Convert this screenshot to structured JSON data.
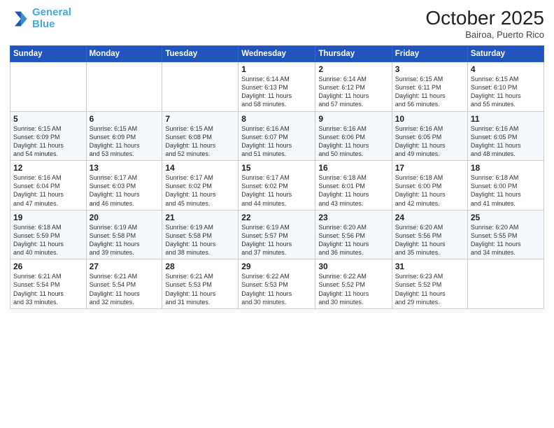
{
  "logo": {
    "line1": "General",
    "line2": "Blue"
  },
  "title": "October 2025",
  "subtitle": "Bairoa, Puerto Rico",
  "days_of_week": [
    "Sunday",
    "Monday",
    "Tuesday",
    "Wednesday",
    "Thursday",
    "Friday",
    "Saturday"
  ],
  "weeks": [
    [
      {
        "day": "",
        "text": ""
      },
      {
        "day": "",
        "text": ""
      },
      {
        "day": "",
        "text": ""
      },
      {
        "day": "1",
        "text": "Sunrise: 6:14 AM\nSunset: 6:13 PM\nDaylight: 11 hours\nand 58 minutes."
      },
      {
        "day": "2",
        "text": "Sunrise: 6:14 AM\nSunset: 6:12 PM\nDaylight: 11 hours\nand 57 minutes."
      },
      {
        "day": "3",
        "text": "Sunrise: 6:15 AM\nSunset: 6:11 PM\nDaylight: 11 hours\nand 56 minutes."
      },
      {
        "day": "4",
        "text": "Sunrise: 6:15 AM\nSunset: 6:10 PM\nDaylight: 11 hours\nand 55 minutes."
      }
    ],
    [
      {
        "day": "5",
        "text": "Sunrise: 6:15 AM\nSunset: 6:09 PM\nDaylight: 11 hours\nand 54 minutes."
      },
      {
        "day": "6",
        "text": "Sunrise: 6:15 AM\nSunset: 6:09 PM\nDaylight: 11 hours\nand 53 minutes."
      },
      {
        "day": "7",
        "text": "Sunrise: 6:15 AM\nSunset: 6:08 PM\nDaylight: 11 hours\nand 52 minutes."
      },
      {
        "day": "8",
        "text": "Sunrise: 6:16 AM\nSunset: 6:07 PM\nDaylight: 11 hours\nand 51 minutes."
      },
      {
        "day": "9",
        "text": "Sunrise: 6:16 AM\nSunset: 6:06 PM\nDaylight: 11 hours\nand 50 minutes."
      },
      {
        "day": "10",
        "text": "Sunrise: 6:16 AM\nSunset: 6:05 PM\nDaylight: 11 hours\nand 49 minutes."
      },
      {
        "day": "11",
        "text": "Sunrise: 6:16 AM\nSunset: 6:05 PM\nDaylight: 11 hours\nand 48 minutes."
      }
    ],
    [
      {
        "day": "12",
        "text": "Sunrise: 6:16 AM\nSunset: 6:04 PM\nDaylight: 11 hours\nand 47 minutes."
      },
      {
        "day": "13",
        "text": "Sunrise: 6:17 AM\nSunset: 6:03 PM\nDaylight: 11 hours\nand 46 minutes."
      },
      {
        "day": "14",
        "text": "Sunrise: 6:17 AM\nSunset: 6:02 PM\nDaylight: 11 hours\nand 45 minutes."
      },
      {
        "day": "15",
        "text": "Sunrise: 6:17 AM\nSunset: 6:02 PM\nDaylight: 11 hours\nand 44 minutes."
      },
      {
        "day": "16",
        "text": "Sunrise: 6:18 AM\nSunset: 6:01 PM\nDaylight: 11 hours\nand 43 minutes."
      },
      {
        "day": "17",
        "text": "Sunrise: 6:18 AM\nSunset: 6:00 PM\nDaylight: 11 hours\nand 42 minutes."
      },
      {
        "day": "18",
        "text": "Sunrise: 6:18 AM\nSunset: 6:00 PM\nDaylight: 11 hours\nand 41 minutes."
      }
    ],
    [
      {
        "day": "19",
        "text": "Sunrise: 6:18 AM\nSunset: 5:59 PM\nDaylight: 11 hours\nand 40 minutes."
      },
      {
        "day": "20",
        "text": "Sunrise: 6:19 AM\nSunset: 5:58 PM\nDaylight: 11 hours\nand 39 minutes."
      },
      {
        "day": "21",
        "text": "Sunrise: 6:19 AM\nSunset: 5:58 PM\nDaylight: 11 hours\nand 38 minutes."
      },
      {
        "day": "22",
        "text": "Sunrise: 6:19 AM\nSunset: 5:57 PM\nDaylight: 11 hours\nand 37 minutes."
      },
      {
        "day": "23",
        "text": "Sunrise: 6:20 AM\nSunset: 5:56 PM\nDaylight: 11 hours\nand 36 minutes."
      },
      {
        "day": "24",
        "text": "Sunrise: 6:20 AM\nSunset: 5:56 PM\nDaylight: 11 hours\nand 35 minutes."
      },
      {
        "day": "25",
        "text": "Sunrise: 6:20 AM\nSunset: 5:55 PM\nDaylight: 11 hours\nand 34 minutes."
      }
    ],
    [
      {
        "day": "26",
        "text": "Sunrise: 6:21 AM\nSunset: 5:54 PM\nDaylight: 11 hours\nand 33 minutes."
      },
      {
        "day": "27",
        "text": "Sunrise: 6:21 AM\nSunset: 5:54 PM\nDaylight: 11 hours\nand 32 minutes."
      },
      {
        "day": "28",
        "text": "Sunrise: 6:21 AM\nSunset: 5:53 PM\nDaylight: 11 hours\nand 31 minutes."
      },
      {
        "day": "29",
        "text": "Sunrise: 6:22 AM\nSunset: 5:53 PM\nDaylight: 11 hours\nand 30 minutes."
      },
      {
        "day": "30",
        "text": "Sunrise: 6:22 AM\nSunset: 5:52 PM\nDaylight: 11 hours\nand 30 minutes."
      },
      {
        "day": "31",
        "text": "Sunrise: 6:23 AM\nSunset: 5:52 PM\nDaylight: 11 hours\nand 29 minutes."
      },
      {
        "day": "",
        "text": ""
      }
    ]
  ]
}
